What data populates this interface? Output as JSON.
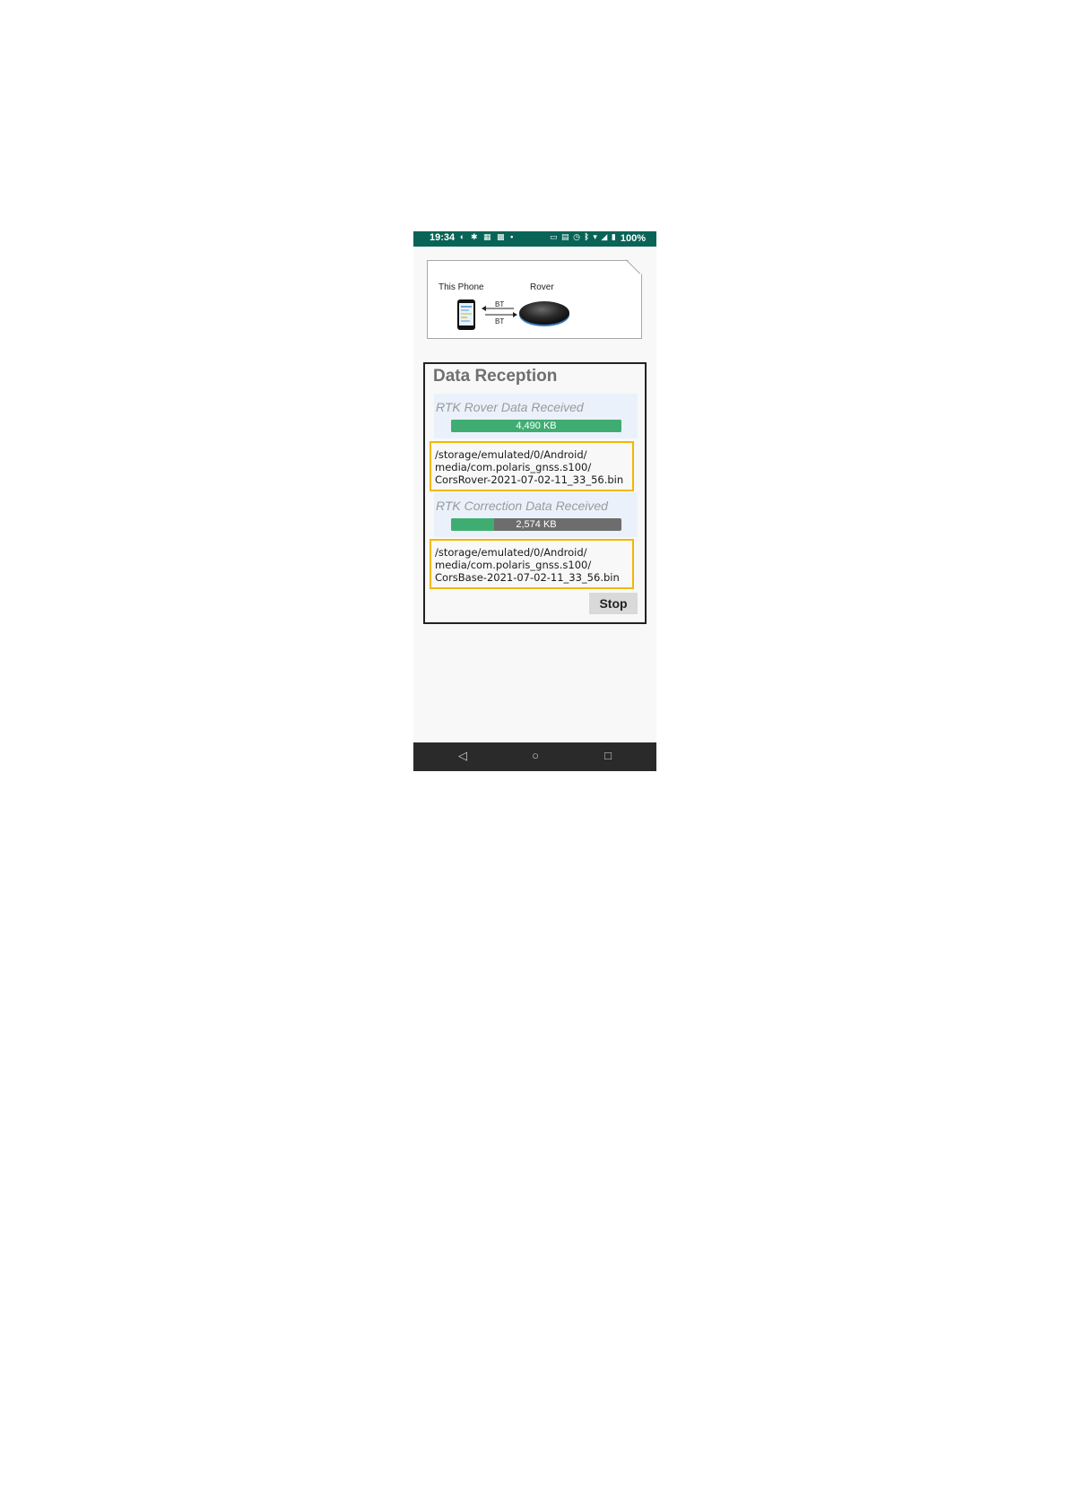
{
  "status_bar": {
    "time": "19:34",
    "battery": "100%",
    "left_icons": [
      "notification-icon",
      "settings-icon",
      "gallery-icon",
      "photo-icon",
      "dot"
    ],
    "right_icons": [
      "cast-icon",
      "nfc-icon",
      "alarm-icon",
      "bluetooth-icon",
      "wifi-icon",
      "signal-icon",
      "battery-icon"
    ],
    "background_color": "#076457"
  },
  "diagram": {
    "phone_label": "This Phone",
    "rover_label": "Rover",
    "link_top_label": "BT",
    "link_bottom_label": "BT"
  },
  "data_reception": {
    "title": "Data Reception",
    "rover": {
      "label": "RTK Rover Data Received",
      "size": "4,490 KB",
      "progress_fraction": 1.0,
      "path": "/storage/emulated/0/Android/\nmedia/com.polaris_gnss.s100/\nCorsRover-2021-07-02-11_33_56.bin"
    },
    "correction": {
      "label": "RTK Correction Data Received",
      "size": "2,574 KB",
      "progress_fraction": 0.25,
      "path": "/storage/emulated/0/Android/\nmedia/com.polaris_gnss.s100/\nCorsBase-2021-07-02-11_33_56.bin"
    },
    "stop_label": "Stop"
  },
  "colors": {
    "progress_fill": "#3fad72",
    "progress_track": "#6d6d6d",
    "path_highlight": "#f3b800"
  },
  "nav_bar": {
    "back": "◁",
    "home": "○",
    "recent": "□"
  }
}
